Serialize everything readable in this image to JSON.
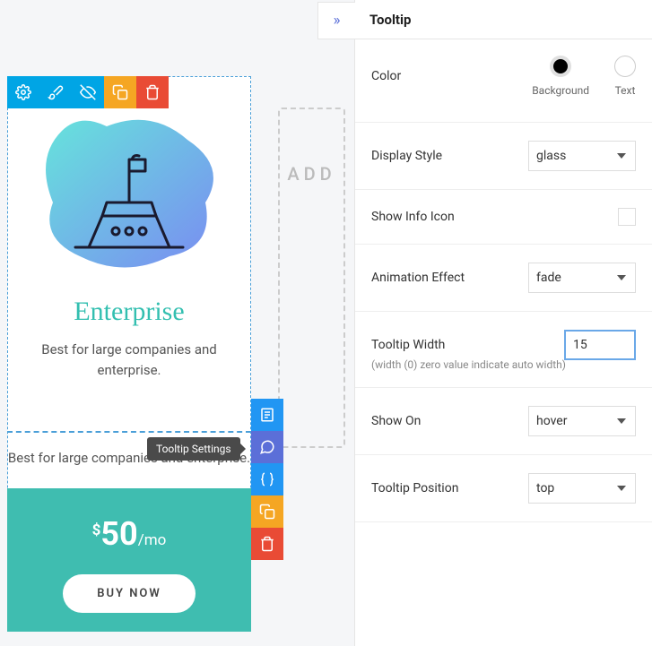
{
  "panel": {
    "title": "Tooltip",
    "color_label": "Color",
    "color_bg": "Background",
    "color_text": "Text",
    "display_style_label": "Display Style",
    "display_style_value": "glass",
    "show_info_label": "Show Info Icon",
    "anim_label": "Animation Effect",
    "anim_value": "fade",
    "width_label": "Tooltip Width",
    "width_value": "15",
    "width_hint": "(width (0) zero value indicate auto width)",
    "show_on_label": "Show On",
    "show_on_value": "hover",
    "position_label": "Tooltip Position",
    "position_value": "top"
  },
  "card": {
    "title": "Enterprise",
    "desc": "Best for large companies and enterprise.",
    "desc2": "Best for large companies and enterprise.",
    "currency": "$",
    "amount": "50",
    "per": "/mo",
    "buy": "BUY NOW"
  },
  "tooltip_badge": "Tooltip Settings",
  "add_text": "ADD"
}
